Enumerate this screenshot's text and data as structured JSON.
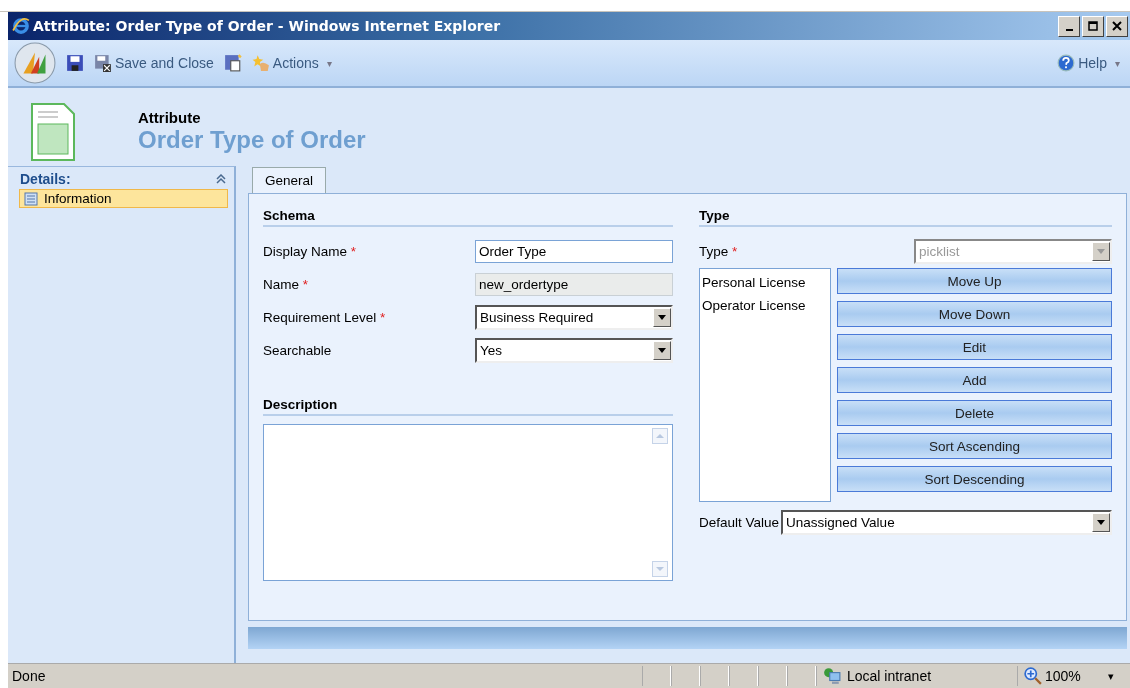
{
  "window": {
    "title": "Attribute: Order Type of Order - Windows Internet Explorer"
  },
  "toolbar": {
    "save_close": "Save and Close",
    "actions": "Actions",
    "actions_caret": "▾",
    "help": "Help",
    "help_caret": "▾"
  },
  "header": {
    "entity": "Attribute",
    "title": "Order Type of Order"
  },
  "sidebar": {
    "title": "Details:",
    "items": [
      {
        "label": "Information",
        "selected": true
      }
    ]
  },
  "tabs": [
    {
      "label": "General",
      "selected": true
    }
  ],
  "schema": {
    "title": "Schema",
    "fields": [
      {
        "kind": "text",
        "label": "Display Name",
        "required": true,
        "value": "Order Type"
      },
      {
        "kind": "readonly",
        "label": "Name",
        "required": true,
        "value": "new_ordertype"
      },
      {
        "kind": "select",
        "label": "Requirement Level",
        "required": true,
        "value": "Business Required"
      },
      {
        "kind": "select",
        "label": "Searchable",
        "required": false,
        "value": "Yes"
      }
    ]
  },
  "required_mark": "*",
  "description": {
    "title": "Description"
  },
  "type_section": {
    "title": "Type",
    "type_label": "Type",
    "type_required": true,
    "type_value": "picklist",
    "type_disabled": true,
    "options": [
      "Personal License",
      "Operator License"
    ],
    "buttons": [
      "Move Up",
      "Move Down",
      "Edit",
      "Add",
      "Delete",
      "Sort Ascending",
      "Sort Descending"
    ],
    "default_label": "Default Value",
    "default_value": "Unassigned Value"
  },
  "status_bar": {
    "status": "Done",
    "zone": "Local intranet",
    "zoom": "100%",
    "zoom_caret": "▾"
  }
}
